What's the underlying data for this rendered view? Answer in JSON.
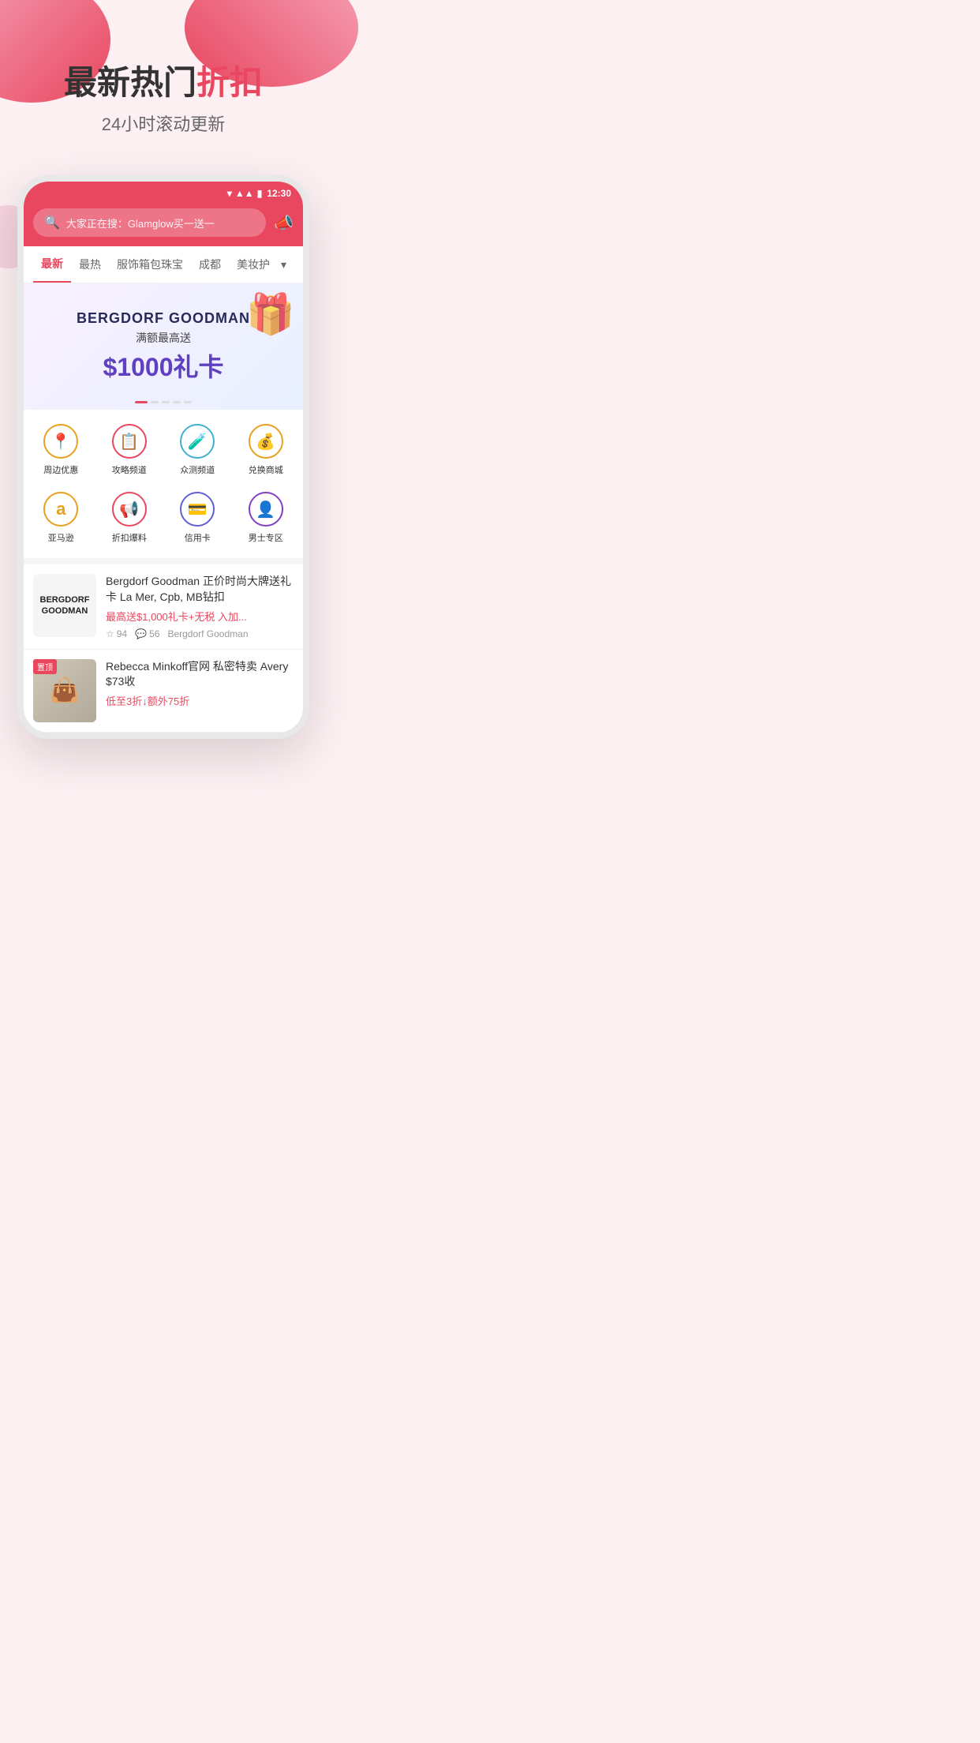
{
  "page": {
    "background_color": "#fdf0f3"
  },
  "hero": {
    "title_main": "最新热门",
    "title_highlight": "折扣",
    "subtitle": "24小时滚动更新"
  },
  "phone": {
    "status_bar": {
      "time": "12:30"
    },
    "search": {
      "placeholder": "大家正在搜：Glamglow买一送一"
    },
    "nav_tabs": [
      {
        "label": "最新",
        "active": true
      },
      {
        "label": "最热",
        "active": false
      },
      {
        "label": "服饰箱包珠宝",
        "active": false
      },
      {
        "label": "成都",
        "active": false
      },
      {
        "label": "美妆护",
        "active": false
      }
    ],
    "banner": {
      "brand": "BERGDORF GOODMAN",
      "subtitle": "满额最高送",
      "amount": "$1000礼卡"
    },
    "icon_grid": [
      {
        "id": "nearby",
        "label": "周边优惠",
        "icon": "📍",
        "color": "#e8a020"
      },
      {
        "id": "guide",
        "label": "攻略频道",
        "icon": "📋",
        "color": "#e8475f"
      },
      {
        "id": "test",
        "label": "众测频道",
        "icon": "🧪",
        "color": "#40b0d0"
      },
      {
        "id": "exchange",
        "label": "兑换商城",
        "icon": "💰",
        "color": "#e8a020"
      },
      {
        "id": "amazon",
        "label": "亚马逊",
        "icon": "a",
        "color": "#e8a020"
      },
      {
        "id": "deals",
        "label": "折扣爆料",
        "icon": "📢",
        "color": "#e8475f"
      },
      {
        "id": "credit",
        "label": "信用卡",
        "icon": "💳",
        "color": "#6060d0"
      },
      {
        "id": "men",
        "label": "男士专区",
        "icon": "👤",
        "color": "#8040c0"
      }
    ],
    "articles": [
      {
        "id": "bergdorf",
        "brand": "BERGDORF\nGOODMAN",
        "title": "Bergdorf Goodman 正价时尚大牌送礼卡 La Mer, Cpb, MB钻扣",
        "subtitle": "最高送$1,000礼卡+无税 入加...",
        "stars": "94",
        "comments": "56",
        "source": "Bergdorf Goodman",
        "pinned": false
      },
      {
        "id": "rebecca",
        "title": "Rebecca Minkoff官网 私密特卖 Avery $73收",
        "subtitle": "低至3折↓额外75折",
        "pinned": true,
        "pinned_label": "置顶"
      }
    ]
  }
}
